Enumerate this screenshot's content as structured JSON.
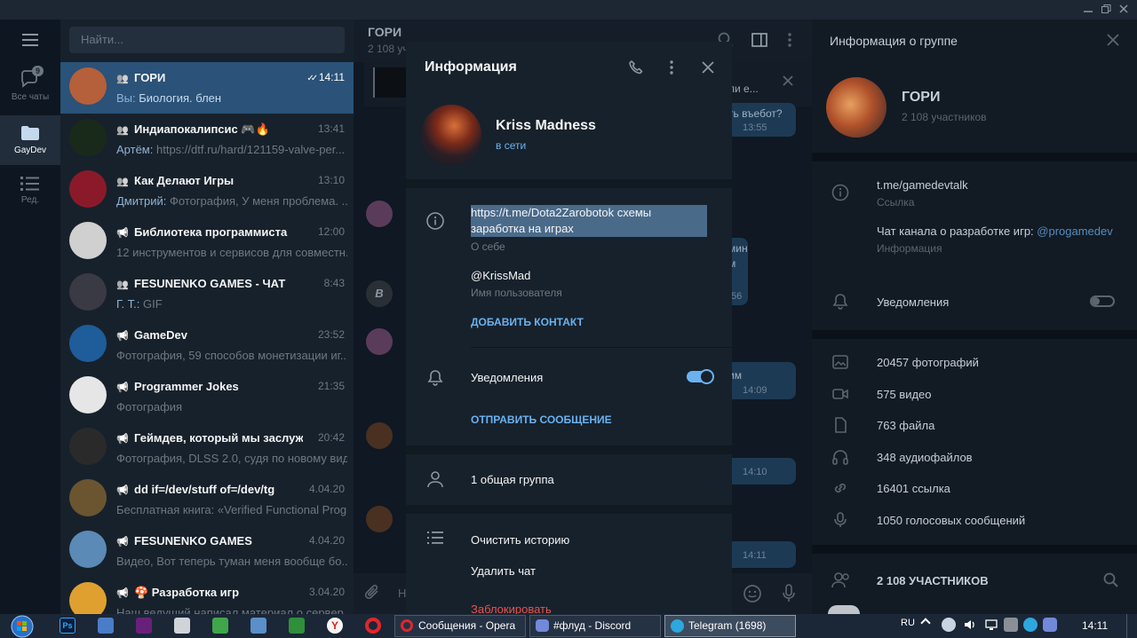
{
  "window": {
    "controls": [
      "minimize",
      "restore",
      "close"
    ]
  },
  "rail": {
    "items": [
      {
        "label": "Все чаты",
        "icon": "chat-bubbles-icon",
        "badge": "9"
      },
      {
        "label": "GayDev",
        "icon": "folder-icon",
        "active": true
      },
      {
        "label": "Ред.",
        "icon": "edit-list-icon"
      }
    ]
  },
  "search": {
    "placeholder": "Найти..."
  },
  "chats": [
    {
      "name": "ГОРИ",
      "type": "group",
      "time": "14:11",
      "read": true,
      "sender": "Вы",
      "preview": "Биология. блен",
      "active": true
    },
    {
      "name": "Индиапокалипсис 🎮🔥",
      "type": "group",
      "time": "13:41",
      "sender": "Артём",
      "preview": "https://dtf.ru/hard/121159-valve-per..."
    },
    {
      "name": "Как Делают Игры",
      "type": "group",
      "time": "13:10",
      "sender": "Дмитрий",
      "preview": "Фотография, У меня проблема. ..."
    },
    {
      "name": "Библиотека программиста",
      "type": "channel",
      "time": "12:00",
      "sender": "",
      "preview": "12 инструментов и сервисов для совместн..."
    },
    {
      "name": "FESUNENKO GAMES - ЧАТ",
      "type": "group",
      "time": "8:43",
      "sender": "Г. Т.",
      "preview": "GIF"
    },
    {
      "name": "GameDev",
      "type": "channel",
      "time": "23:52",
      "sender": "",
      "preview": "Фотография, 59 способов монетизации иг..."
    },
    {
      "name": "Programmer Jokes",
      "type": "channel",
      "time": "21:35",
      "sender": "",
      "preview": "Фотография"
    },
    {
      "name": "Геймдев, который мы заслужи...",
      "type": "channel",
      "time": "20:42",
      "sender": "",
      "preview": "Фотография, DLSS 2.0, судя по новому вид..."
    },
    {
      "name": "dd if=/dev/stuff of=/dev/tg",
      "type": "channel",
      "time": "4.04.20",
      "sender": "",
      "preview": "Бесплатная книга: «Verified Functional Prog..."
    },
    {
      "name": "FESUNENKO GAMES",
      "type": "channel",
      "time": "4.04.20",
      "sender": "",
      "preview": "Видео, Вот теперь туман меня вообще бо..."
    },
    {
      "name": "🍄 Разработка игр",
      "type": "channel",
      "time": "3.04.20",
      "sender": "",
      "preview": "Наш ведущий написал материал о сервер..."
    }
  ],
  "middle": {
    "title": "ГОРИ",
    "subtitle": "2 108 уч",
    "pinned": "ли е...",
    "bubbles": [
      {
        "text": "ть въебот?",
        "time": "13:55"
      },
      {
        "text": "мин",
        "time": ""
      },
      {
        "text": "м",
        "time": ":56"
      },
      {
        "text": "им",
        "time": "14:09"
      },
      {
        "text": "",
        "time": "14:10"
      },
      {
        "text": "",
        "time": "14:11"
      }
    ],
    "composer_hint": "Н"
  },
  "modal": {
    "title": "Информация",
    "name": "Kriss Madness",
    "status": "в сети",
    "bio": "https://t.me/Dota2Zarobotok схемы заработка на играх",
    "bio_label": "О себе",
    "username": "@KrissMad",
    "username_label": "Имя пользователя",
    "add_contact": "ДОБАВИТЬ КОНТАКТ",
    "notifications": "Уведомления",
    "send_message": "ОТПРАВИТЬ СООБЩЕНИЕ",
    "common_groups": "1 общая группа",
    "clear_history": "Очистить историю",
    "delete_chat": "Удалить чат",
    "block": "Заблокировать"
  },
  "info": {
    "title": "Информация о группе",
    "group_name": "ГОРИ",
    "members_count": "2 108 участников",
    "link": "t.me/gamedevtalk",
    "link_label": "Ссылка",
    "description_prefix": "Чат канала о разработке игр: ",
    "description_mention": "@progamedev",
    "description_label": "Информация",
    "notifications": "Уведомления",
    "media": [
      {
        "icon": "photo-icon",
        "label": "20457 фотографий"
      },
      {
        "icon": "video-icon",
        "label": "575 видео"
      },
      {
        "icon": "file-icon",
        "label": "763 файла"
      },
      {
        "icon": "headphones-icon",
        "label": "348 аудиофайлов"
      },
      {
        "icon": "link-icon",
        "label": "16401 ссылка"
      },
      {
        "icon": "mic-icon",
        "label": "1050 голосовых сообщений"
      }
    ],
    "members_header": "2 108 УЧАСТНИКОВ"
  },
  "taskbar": {
    "tasks": [
      {
        "label": "Сообщения - Opera"
      },
      {
        "label": "#флуд - Discord"
      },
      {
        "label": "Telegram (1698)",
        "active": true
      }
    ],
    "lang": "RU",
    "clock": "14:11"
  },
  "colors": {
    "accent": "#6ab2f2",
    "active_row": "#2b5278",
    "panel_bg": "#17212b",
    "danger": "#e8534f"
  }
}
